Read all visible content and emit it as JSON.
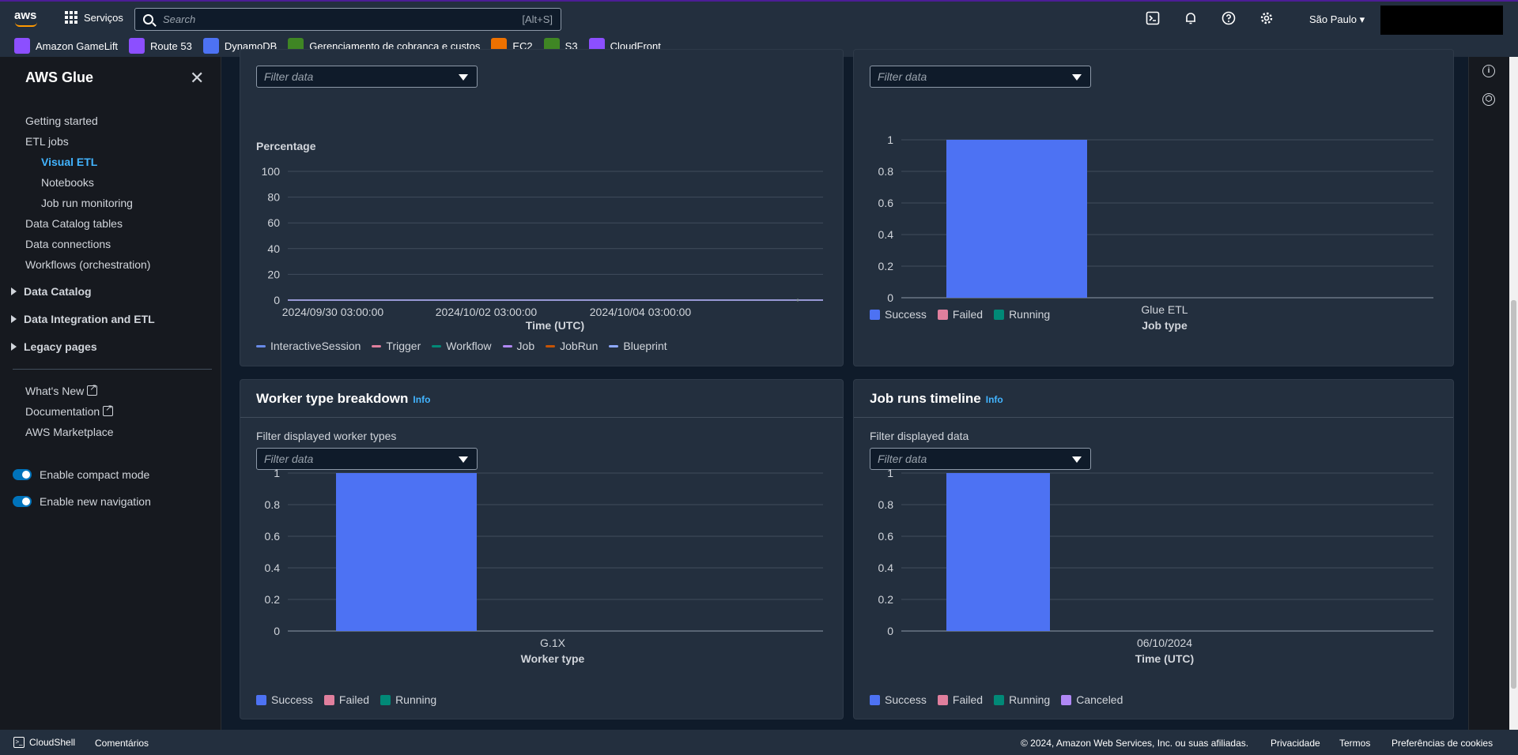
{
  "topbar": {
    "logo": "aws",
    "services_label": "Serviços",
    "search_placeholder": "Search",
    "search_shortcut": "[Alt+S]",
    "region": "São Paulo"
  },
  "favorites": [
    {
      "label": "Amazon GameLift",
      "color": "#8c4fff"
    },
    {
      "label": "Route 53",
      "color": "#8c4fff"
    },
    {
      "label": "DynamoDB",
      "color": "#4d72f3"
    },
    {
      "label": "Gerenciamento de cobrança e custos",
      "color": "#3f8624"
    },
    {
      "label": "EC2",
      "color": "#ed7100"
    },
    {
      "label": "S3",
      "color": "#3f8624"
    },
    {
      "label": "CloudFront",
      "color": "#8c4fff"
    }
  ],
  "sidebar": {
    "title": "AWS Glue",
    "links": {
      "getting_started": "Getting started",
      "etl_jobs": "ETL jobs",
      "visual_etl": "Visual ETL",
      "notebooks": "Notebooks",
      "job_run_monitoring": "Job run monitoring",
      "data_catalog_tables": "Data Catalog tables",
      "data_connections": "Data connections",
      "workflows": "Workflows (orchestration)"
    },
    "sections": {
      "data_catalog": "Data Catalog",
      "data_integration": "Data Integration and ETL",
      "legacy": "Legacy pages"
    },
    "whats_new": "What's New",
    "documentation": "Documentation",
    "marketplace": "AWS Marketplace",
    "compact_mode": "Enable compact mode",
    "new_navigation": "Enable new navigation"
  },
  "filter_placeholder": "Filter data",
  "panels": {
    "top_left": {
      "legend": [
        {
          "name": "InteractiveSession",
          "color": "#688ae8"
        },
        {
          "name": "Trigger",
          "color": "#e07f9d"
        },
        {
          "name": "Workflow",
          "color": "#018977"
        },
        {
          "name": "Job",
          "color": "#b088f5"
        },
        {
          "name": "JobRun",
          "color": "#c55305"
        },
        {
          "name": "Blueprint",
          "color": "#8ea9ff"
        }
      ]
    },
    "top_right": {
      "legend": [
        {
          "name": "Success",
          "color": "#4d72f3"
        },
        {
          "name": "Failed",
          "color": "#e07f9d"
        },
        {
          "name": "Running",
          "color": "#018977"
        }
      ]
    },
    "worker": {
      "title": "Worker type breakdown",
      "info": "Info",
      "filter_label": "Filter displayed worker types",
      "legend": [
        {
          "name": "Success",
          "color": "#4d72f3"
        },
        {
          "name": "Failed",
          "color": "#e07f9d"
        },
        {
          "name": "Running",
          "color": "#018977"
        }
      ]
    },
    "timeline": {
      "title": "Job runs timeline",
      "info": "Info",
      "filter_label": "Filter displayed data",
      "legend": [
        {
          "name": "Success",
          "color": "#4d72f3"
        },
        {
          "name": "Failed",
          "color": "#e07f9d"
        },
        {
          "name": "Running",
          "color": "#018977"
        },
        {
          "name": "Canceled",
          "color": "#b088f5"
        }
      ]
    }
  },
  "chart_data": [
    {
      "type": "line",
      "ylabel": "Percentage",
      "xlabel": "Time (UTC)",
      "ylim": [
        0,
        100
      ],
      "yticks": [
        "0",
        "20",
        "40",
        "60",
        "80",
        "100"
      ],
      "xticks": [
        "2024/09/30 03:00:00",
        "2024/10/02 03:00:00",
        "2024/10/04 03:00:00"
      ],
      "series": [
        {
          "name": "InteractiveSession",
          "values": [
            0,
            0,
            0,
            0
          ]
        },
        {
          "name": "Trigger",
          "values": [
            0,
            0,
            0,
            0
          ]
        },
        {
          "name": "Workflow",
          "values": [
            0,
            0,
            0,
            0
          ]
        },
        {
          "name": "Job",
          "values": [
            0,
            0,
            0,
            0
          ]
        },
        {
          "name": "JobRun",
          "values": [
            0,
            0,
            0,
            0
          ]
        },
        {
          "name": "Blueprint",
          "values": [
            0,
            0,
            0,
            0
          ]
        }
      ],
      "grid": true,
      "legend": "bottom"
    },
    {
      "type": "bar",
      "xlabel": "Job type",
      "categories": [
        "Glue ETL"
      ],
      "ylim": [
        0,
        1
      ],
      "yticks": [
        "0",
        "0.2",
        "0.4",
        "0.6",
        "0.8",
        "1"
      ],
      "series": [
        {
          "name": "Success",
          "values": [
            1
          ]
        }
      ],
      "grid": true,
      "legend": "bottom"
    },
    {
      "type": "bar",
      "xlabel": "Worker type",
      "categories": [
        "G.1X"
      ],
      "ylim": [
        0,
        1
      ],
      "yticks": [
        "0",
        "0.2",
        "0.4",
        "0.6",
        "0.8",
        "1"
      ],
      "series": [
        {
          "name": "Success",
          "values": [
            1
          ]
        }
      ],
      "grid": true,
      "legend": "bottom"
    },
    {
      "type": "bar",
      "xlabel": "Time (UTC)",
      "categories": [
        "06/10/2024"
      ],
      "ylim": [
        0,
        1
      ],
      "yticks": [
        "0",
        "0.2",
        "0.4",
        "0.6",
        "0.8",
        "1"
      ],
      "series": [
        {
          "name": "Success",
          "values": [
            1
          ]
        }
      ],
      "grid": true,
      "legend": "bottom"
    }
  ],
  "footer": {
    "cloudshell": "CloudShell",
    "feedback": "Comentários",
    "copyright": "© 2024, Amazon Web Services, Inc. ou suas afiliadas.",
    "privacy": "Privacidade",
    "terms": "Termos",
    "cookies": "Preferências de cookies"
  }
}
